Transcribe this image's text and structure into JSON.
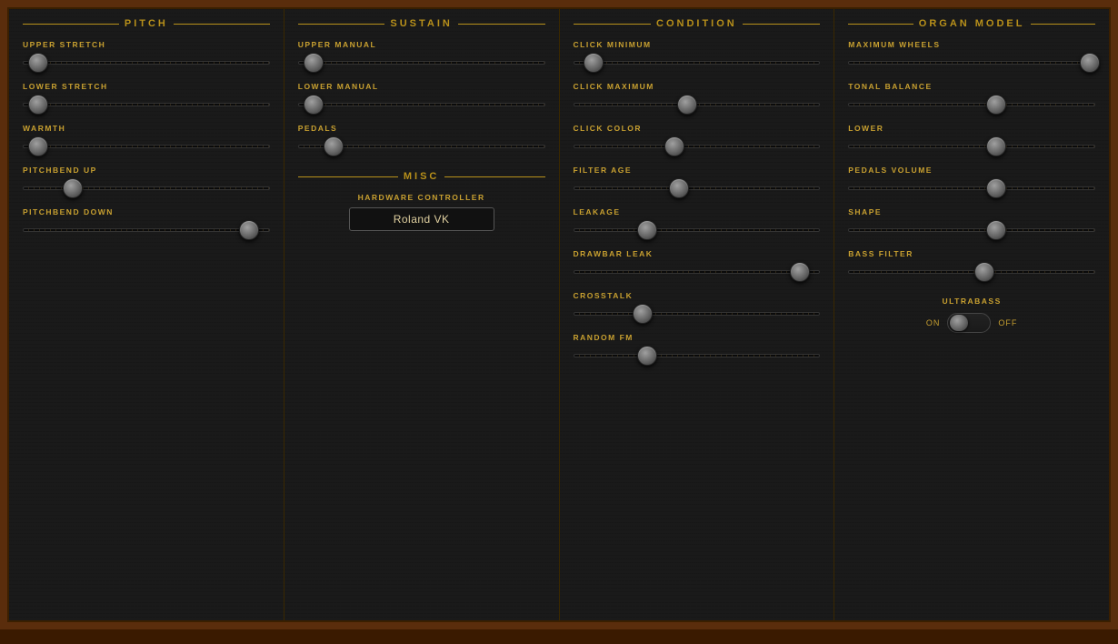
{
  "sections": [
    {
      "id": "pitch",
      "title": "PITCH",
      "params": [
        {
          "id": "upper-stretch",
          "label": "UPPER STRETCH",
          "value": 0.06
        },
        {
          "id": "lower-stretch",
          "label": "LOWER STRETCH",
          "value": 0.06
        },
        {
          "id": "warmth",
          "label": "WARMTH",
          "value": 0.06
        },
        {
          "id": "pitchbend-up",
          "label": "PITCHBEND UP",
          "value": 0.2
        },
        {
          "id": "pitchbend-down",
          "label": "PITCHBEND DOWN",
          "value": 0.92
        }
      ]
    },
    {
      "id": "sustain",
      "title": "SUSTAIN",
      "params": [
        {
          "id": "upper-manual",
          "label": "UPPER MANUAL",
          "value": 0.06
        },
        {
          "id": "lower-manual",
          "label": "LOWER MANUAL",
          "value": 0.06
        },
        {
          "id": "pedals",
          "label": "PEDALS",
          "value": 0.14
        }
      ],
      "misc": {
        "title": "MISC",
        "hardware_label": "HARDWARE CONTROLLER",
        "hardware_value": "Roland VK"
      }
    },
    {
      "id": "condition",
      "title": "CONDITION",
      "params": [
        {
          "id": "click-minimum",
          "label": "CLICK MINIMUM",
          "value": 0.08
        },
        {
          "id": "click-maximum",
          "label": "CLICK MAXIMUM",
          "value": 0.46
        },
        {
          "id": "click-color",
          "label": "CLICK COLOR",
          "value": 0.41
        },
        {
          "id": "filter-age",
          "label": "FILTER AGE",
          "value": 0.43
        },
        {
          "id": "leakage",
          "label": "LEAKAGE",
          "value": 0.3
        },
        {
          "id": "drawbar-leak",
          "label": "DRAWBAR LEAK",
          "value": 0.92
        },
        {
          "id": "crosstalk",
          "label": "CROSSTALK",
          "value": 0.28
        },
        {
          "id": "random-fm",
          "label": "RANDOM FM",
          "value": 0.3
        }
      ]
    },
    {
      "id": "organ-model",
      "title": "ORGAN MODEL",
      "params": [
        {
          "id": "maximum-wheels",
          "label": "MAXIMUM WHEELS",
          "value": 0.98
        },
        {
          "id": "tonal-balance",
          "label": "TONAL BALANCE",
          "value": 0.6
        },
        {
          "id": "lower",
          "label": "LOWER",
          "value": 0.6
        },
        {
          "id": "pedals-volume",
          "label": "PEDALS VOLUME",
          "value": 0.6
        },
        {
          "id": "shape",
          "label": "SHAPE",
          "value": 0.6
        },
        {
          "id": "bass-filter",
          "label": "BASS FILTER",
          "value": 0.55
        }
      ],
      "ultrabass": {
        "label": "ULTRABASS",
        "on_label": "ON",
        "off_label": "OFF",
        "state": "on"
      }
    }
  ]
}
